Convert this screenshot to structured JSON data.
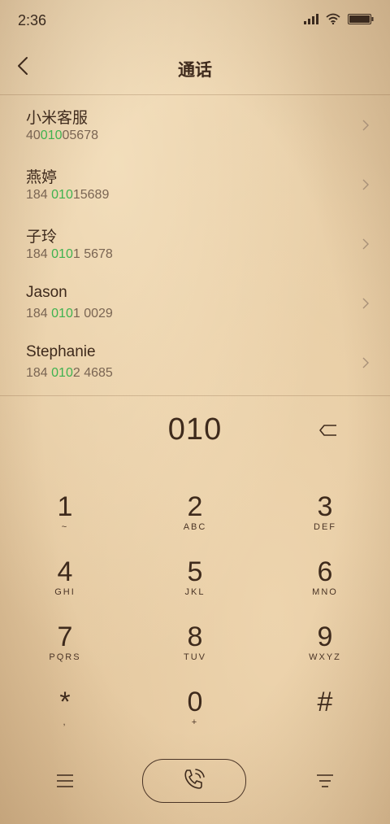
{
  "status_bar": {
    "time": "2:36",
    "icons": [
      "signal-icon",
      "wifi-icon",
      "battery-icon"
    ]
  },
  "header": {
    "title": "通话",
    "back_icon": "chevron-left-icon"
  },
  "results": [
    {
      "name": "小米客服",
      "number_pre": "40",
      "number_match": "010",
      "number_post": "05678"
    },
    {
      "name": "燕婷",
      "number_pre": "184 ",
      "number_match": "010",
      "number_post": "15689"
    },
    {
      "name": "子玲",
      "number_pre": "184 ",
      "number_match": "010",
      "number_post": "1 5678"
    },
    {
      "name": "Jason",
      "number_pre": "184 ",
      "number_match": "010",
      "number_post": "1 0029"
    },
    {
      "name": "Stephanie",
      "number_pre": "184 ",
      "number_match": "010",
      "number_post": "2 4685"
    }
  ],
  "dial": {
    "digits": "010",
    "backspace_icon": "backspace-icon"
  },
  "keypad": [
    {
      "digit": "1",
      "letters": "~"
    },
    {
      "digit": "2",
      "letters": "ABC"
    },
    {
      "digit": "3",
      "letters": "DEF"
    },
    {
      "digit": "4",
      "letters": "GHI"
    },
    {
      "digit": "5",
      "letters": "JKL"
    },
    {
      "digit": "6",
      "letters": "MNO"
    },
    {
      "digit": "7",
      "letters": "PQRS"
    },
    {
      "digit": "8",
      "letters": "TUV"
    },
    {
      "digit": "9",
      "letters": "WXYZ"
    },
    {
      "digit": "*",
      "letters": ","
    },
    {
      "digit": "0",
      "letters": "+"
    },
    {
      "digit": "#",
      "letters": ""
    }
  ],
  "bottom_bar": {
    "left_icon": "menu-icon",
    "center_icon": "phone-call-icon",
    "right_icon": "filter-icon"
  },
  "colors": {
    "match_highlight": "#3fb24f",
    "text_primary": "#3e2a1c",
    "text_secondary": "#7a6553",
    "background": "#e6cba3"
  }
}
